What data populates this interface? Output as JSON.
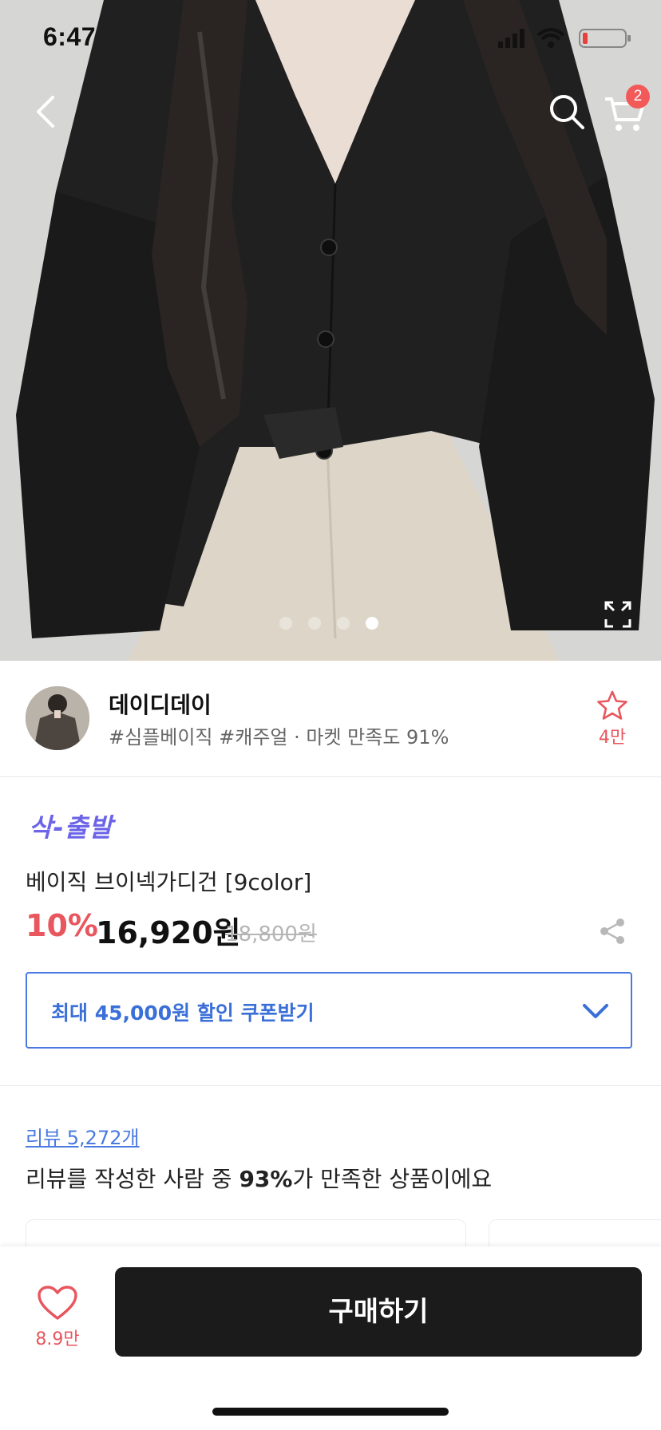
{
  "status_bar": {
    "time": "6:47"
  },
  "header": {
    "cart_count": "2"
  },
  "gallery": {
    "total_images": 4,
    "active_index": 3
  },
  "shop": {
    "name": "데이디데이",
    "tags": "#심플베이직 #캐주얼 · 마켓 만족도 91%",
    "favorite_count": "4만"
  },
  "product": {
    "delivery_badge": "삭-출발",
    "title": "베이직 브이넥가디건 [9color]",
    "discount": "10%",
    "price": "16,920원",
    "original_price": "18,800원"
  },
  "coupon": {
    "label": "최대 45,000원 할인 쿠폰받기"
  },
  "reviews": {
    "link_text": "리뷰 5,272개",
    "summary_prefix": "리뷰를 작성한 사람 중 ",
    "summary_percent": "93%",
    "summary_suffix": "가 만족한 상품이에요"
  },
  "bottom_bar": {
    "like_count": "8.9만",
    "buy_label": "구매하기"
  },
  "colors": {
    "accent_red": "#e8565e",
    "accent_blue": "#4a7ae0",
    "accent_purple": "#6b63e8",
    "buy_button": "#1b1b1b"
  }
}
